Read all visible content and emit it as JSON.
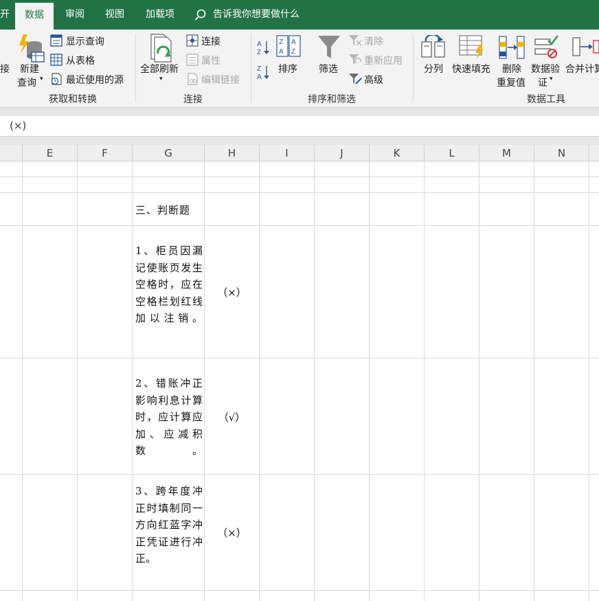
{
  "tabs": {
    "partial": "开",
    "data": "数据",
    "review": "审阅",
    "view": "视图",
    "addins": "加载项",
    "tell_me": "告诉我你想要做什么"
  },
  "ribbon": {
    "get_transform": {
      "partial_left": "接",
      "new_query_line1": "新建",
      "new_query_line2": "查询",
      "show_queries": "显示查询",
      "from_table": "从表格",
      "recent_sources": "最近使用的源",
      "label": "获取和转换"
    },
    "connections": {
      "refresh_all": "全部刷新",
      "connections": "连接",
      "properties": "属性",
      "edit_links": "编辑链接",
      "label": "连接"
    },
    "sort_filter": {
      "sort": "排序",
      "filter": "筛选",
      "clear": "清除",
      "reapply": "重新应用",
      "advanced": "高级",
      "label": "排序和筛选"
    },
    "data_tools": {
      "text_to_columns": "分列",
      "flash_fill": "快速填充",
      "remove_duplicates_line1": "删除",
      "remove_duplicates_line2": "重复值",
      "data_validation_line1": "数据验",
      "data_validation_line2": "证",
      "consolidate": "合并计算",
      "label": "数据工具"
    }
  },
  "formula_bar": {
    "content": "(×)"
  },
  "columns": [
    "E",
    "F",
    "G",
    "H",
    "I",
    "J",
    "K",
    "L",
    "M",
    "N"
  ],
  "sheet": {
    "section_title": "三、判断题",
    "questions": [
      {
        "text": "1、柜员因漏记使账页发生空格时，应在空格栏划红线加以注销。",
        "answer": "（×）"
      },
      {
        "text": "2、错账冲正影响利息计算时，应计算应加、应减积数。",
        "answer": "（√）"
      },
      {
        "text": "3、跨年度冲正时填制同一方向红蓝字冲正凭证进行冲正。",
        "answer": "（×）"
      }
    ]
  }
}
